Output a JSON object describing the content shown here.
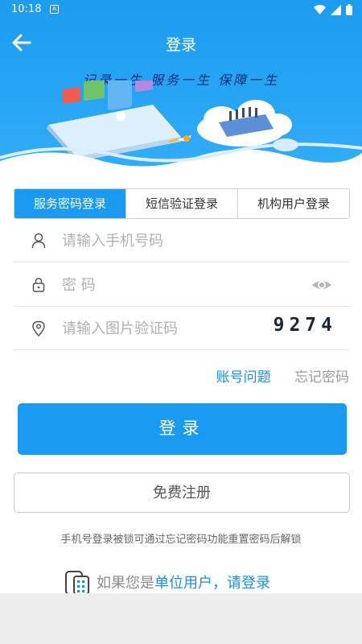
{
  "status_bar": {
    "time": "10:18",
    "notification_icon": "A"
  },
  "nav": {
    "title": "登录"
  },
  "banner": {
    "slogan": "记录一生  服务一生  保障一生"
  },
  "tabs": [
    {
      "label": "服务密码登录",
      "active": true
    },
    {
      "label": "短信验证登录",
      "active": false
    },
    {
      "label": "机构用户登录",
      "active": false
    }
  ],
  "form": {
    "phone_placeholder": "请输入手机号码",
    "password_placeholder": "密 码",
    "captcha_placeholder": "请输入图片验证码",
    "captcha_code": "9274"
  },
  "links": {
    "account_issue": "账号问题",
    "forgot_password": "忘记密码"
  },
  "buttons": {
    "login": "登录",
    "register": "免费注册"
  },
  "notice": "手机号登录被锁可通过忘记密码功能重置密码后解锁",
  "unit_login": {
    "prefix": "如果您是",
    "link": "单位用户，请登录"
  },
  "colors": {
    "primary": "#1a9af0",
    "header_top": "#1d9cf0",
    "slogan": "#0b2e7a",
    "link": "#1a8fe0"
  }
}
